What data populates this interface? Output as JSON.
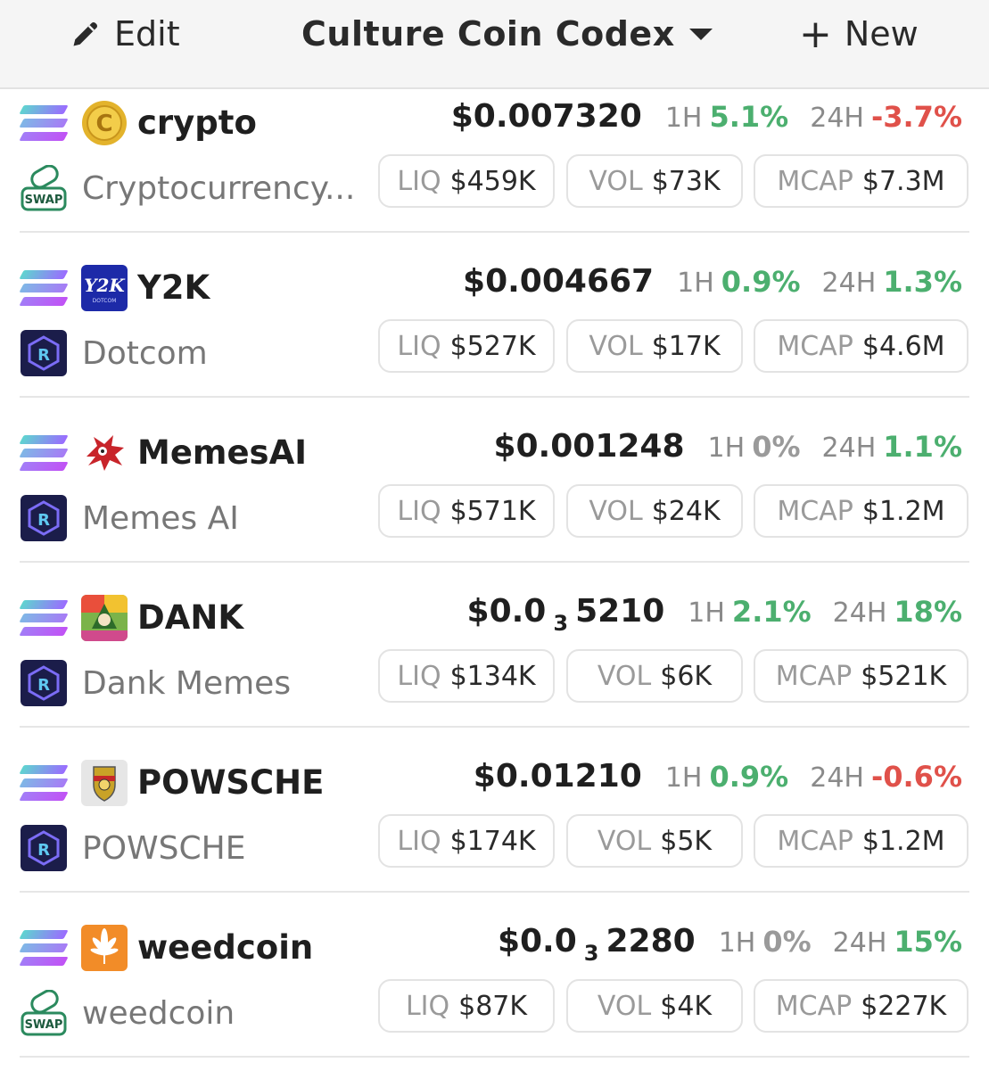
{
  "toolbar": {
    "edit_label": "Edit",
    "title": "Culture Coin Codex",
    "new_label": "New"
  },
  "labels": {
    "one_hour": "1H",
    "twenty_four_hour": "24H",
    "liq": "LIQ",
    "vol": "VOL",
    "mcap": "MCAP"
  },
  "rows": [
    {
      "symbol": "crypto",
      "name": "Cryptocurrency...",
      "logo": "gold-coin-icon",
      "dex": "swap-icon",
      "price": "$0.007320",
      "price_sub": "",
      "price_tail": "",
      "h1": "5.1%",
      "h1_color": "green",
      "h24": "-3.7%",
      "h24_color": "red",
      "liq": "$459K",
      "vol": "$73K",
      "mcap": "$7.3M"
    },
    {
      "symbol": "Y2K",
      "name": "Dotcom",
      "logo": "y2k-dotcom-icon",
      "dex": "raydium-icon",
      "price": "$0.004667",
      "price_sub": "",
      "price_tail": "",
      "h1": "0.9%",
      "h1_color": "green",
      "h24": "1.3%",
      "h24_color": "green",
      "liq": "$527K",
      "vol": "$17K",
      "mcap": "$4.6M"
    },
    {
      "symbol": "MemesAI",
      "name": "Memes AI",
      "logo": "red-creature-icon",
      "dex": "raydium-icon",
      "price": "$0.001248",
      "price_sub": "",
      "price_tail": "",
      "h1": "0%",
      "h1_color": "gray",
      "h24": "1.1%",
      "h24_color": "green",
      "liq": "$571K",
      "vol": "$24K",
      "mcap": "$1.2M"
    },
    {
      "symbol": "DANK",
      "name": "Dank Memes",
      "logo": "dank-meme-icon",
      "dex": "raydium-icon",
      "price": "$0.0",
      "price_sub": "3",
      "price_tail": "5210",
      "h1": "2.1%",
      "h1_color": "green",
      "h24": "18%",
      "h24_color": "green",
      "liq": "$134K",
      "vol": "$6K",
      "mcap": "$521K"
    },
    {
      "symbol": "POWSCHE",
      "name": "POWSCHE",
      "logo": "porsche-crest-icon",
      "dex": "raydium-icon",
      "price": "$0.01210",
      "price_sub": "",
      "price_tail": "",
      "h1": "0.9%",
      "h1_color": "green",
      "h24": "-0.6%",
      "h24_color": "red",
      "liq": "$174K",
      "vol": "$5K",
      "mcap": "$1.2M"
    },
    {
      "symbol": "weedcoin",
      "name": "weedcoin",
      "logo": "cannabis-leaf-icon",
      "dex": "swap-icon",
      "price": "$0.0",
      "price_sub": "3",
      "price_tail": "2280",
      "h1": "0%",
      "h1_color": "gray",
      "h24": "15%",
      "h24_color": "green",
      "liq": "$87K",
      "vol": "$4K",
      "mcap": "$227K"
    }
  ]
}
